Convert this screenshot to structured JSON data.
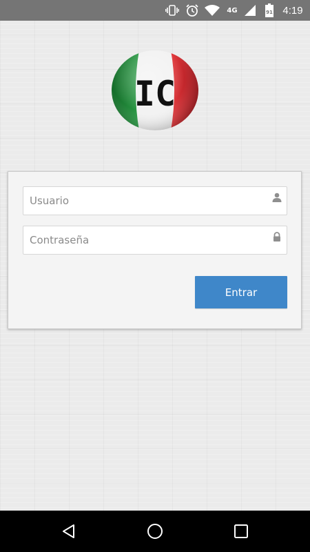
{
  "status_bar": {
    "network": "4G",
    "battery": "91",
    "time": "4:19",
    "icons": [
      "vibrate-icon",
      "alarm-icon",
      "wifi-icon",
      "signal-icon",
      "battery-icon"
    ]
  },
  "logo": {
    "text": "IC",
    "colors": {
      "green": "#1f8a3a",
      "white": "#f4f4f4",
      "red": "#d3202a"
    }
  },
  "login": {
    "username_placeholder": "Usuario",
    "username_value": "",
    "password_placeholder": "Contraseña",
    "password_value": "",
    "submit_label": "Entrar",
    "accent_color": "#3f87c9"
  },
  "nav_bar": {
    "icons": [
      "back-icon",
      "home-icon",
      "recents-icon"
    ]
  }
}
